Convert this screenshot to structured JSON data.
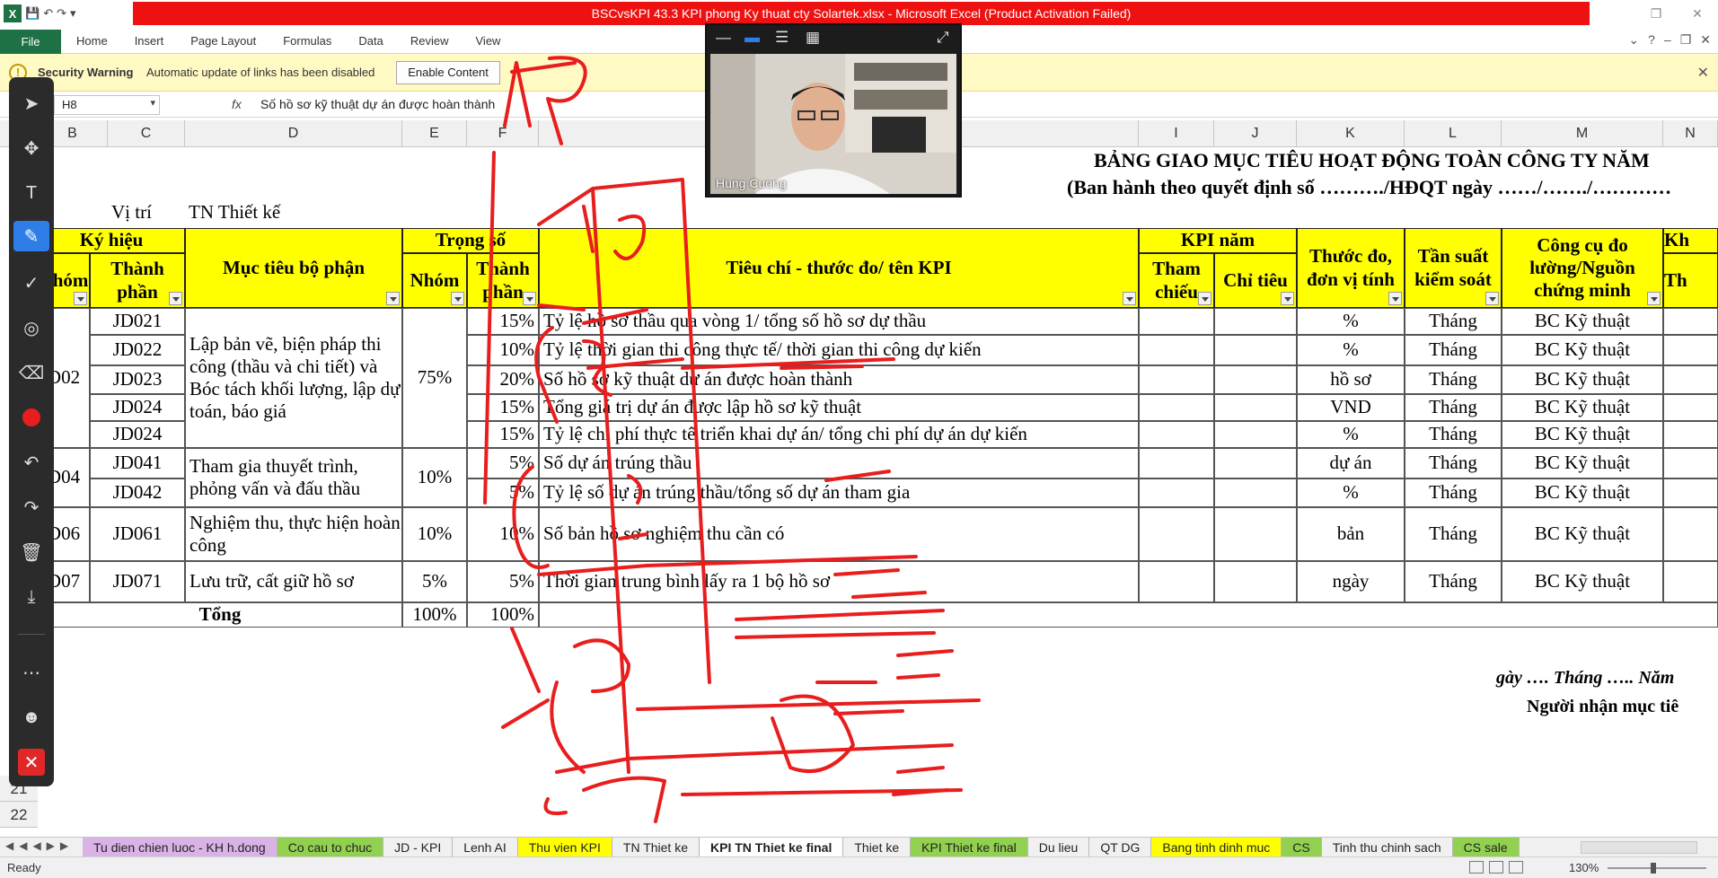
{
  "window": {
    "title": "BSCvsKPI 43.3 KPI phong Ky thuat cty Solartek.xlsx - Microsoft Excel (Product Activation Failed)",
    "app_icon": "X"
  },
  "ribbon": {
    "file": "File",
    "tabs": [
      "Home",
      "Insert",
      "Page Layout",
      "Formulas",
      "Data",
      "Review",
      "View"
    ]
  },
  "security": {
    "label": "Security Warning",
    "message": "Automatic update of links has been disabled",
    "button": "Enable Content"
  },
  "formula_bar": {
    "name_box": "H8",
    "fx": "fx",
    "formula": "Số hồ sơ kỹ thuật dự án được hoàn thành"
  },
  "columns": [
    "B",
    "C",
    "D",
    "E",
    "F",
    "I",
    "J",
    "K",
    "L",
    "M",
    "N"
  ],
  "sheet": {
    "title": "BẢNG GIAO MỤC TIÊU HOẠT ĐỘNG TOÀN CÔNG TY NĂM",
    "subtitle": "(Ban hành theo quyết định số ………./HĐQT ngày ……/……./…………",
    "position_label": "Vị trí",
    "position_value": "TN Thiết kế",
    "headers": {
      "ky_hieu": "Ký hiệu",
      "nhom": "Nhóm",
      "thanh_phan": "Thành phần",
      "muc_tieu": "Mục tiêu bộ phận",
      "trong_so": "Trọng số",
      "tieu_chi": "Tiêu chí - thước đo/ tên KPI",
      "kpi_nam": "KPI năm",
      "tham_chieu": "Tham chiếu",
      "chi_tieu": "Chỉ tiêu",
      "thuoc_do": "Thước đo, đơn vị tính",
      "tan_suat": "Tần suất kiểm soát",
      "cong_cu": "Công cụ đo lường/Nguồn chứng minh",
      "kh": "Kh",
      "th": "Th",
      "tha": "thá"
    },
    "groups": [
      {
        "code": "D02",
        "objective": "Lập bản vẽ, biện pháp thi công (thầu và chi tiết) và Bóc tách khối lượng, lập dự toán, báo giá",
        "weight": "75%"
      },
      {
        "code": "D04",
        "objective": "Tham gia thuyết trình, phỏng vấn và đấu thầu",
        "weight": "10%"
      },
      {
        "code": "D06",
        "objective": "Nghiệm thu, thực hiện hoàn công",
        "weight": "10%"
      },
      {
        "code": "D07",
        "objective": "Lưu trữ, cất giữ hồ sơ",
        "weight": "5%"
      }
    ],
    "rows": [
      {
        "code": "JD021",
        "weight": "15%",
        "kpi": "Tỷ lệ hồ sơ thầu qua vòng 1/ tổng số hồ sơ dự thầu",
        "unit": "%",
        "freq": "Tháng",
        "tool": "BC Kỹ thuật"
      },
      {
        "code": "JD022",
        "weight": "10%",
        "kpi": "Tỷ lệ thời gian thi công thực tế/ thời gian thi công dự kiến",
        "unit": "%",
        "freq": "Tháng",
        "tool": "BC Kỹ thuật"
      },
      {
        "code": "JD023",
        "weight": "20%",
        "kpi": "Số hồ sơ kỹ thuật dự án được hoàn thành",
        "unit": "hồ sơ",
        "freq": "Tháng",
        "tool": "BC Kỹ thuật"
      },
      {
        "code": "JD024",
        "weight": "15%",
        "kpi": "Tổng giá trị dự án được lập hồ sơ kỹ thuật",
        "unit": "VND",
        "freq": "Tháng",
        "tool": "BC Kỹ thuật"
      },
      {
        "code": "JD024",
        "weight": "15%",
        "kpi": "Tỷ lệ chi phí thực tế triển khai dự án/ tổng chi phí dự án dự kiến",
        "unit": "%",
        "freq": "Tháng",
        "tool": "BC Kỹ thuật"
      },
      {
        "code": "JD041",
        "weight": "5%",
        "kpi": "Số dự án trúng thầu",
        "unit": "dự án",
        "freq": "Tháng",
        "tool": "BC Kỹ thuật"
      },
      {
        "code": "JD042",
        "weight": "5%",
        "kpi": "Tỷ lệ số dự án trúng thầu/tổng số dự án tham gia",
        "unit": "%",
        "freq": "Tháng",
        "tool": "BC Kỹ thuật"
      },
      {
        "code": "JD061",
        "weight": "10%",
        "kpi": "Số bản hồ sơ nghiệm thu cần có",
        "unit": "bản",
        "freq": "Tháng",
        "tool": "BC Kỹ thuật"
      },
      {
        "code": "JD071",
        "weight": "5%",
        "kpi": "Thời gian trung bình lấy ra 1 bộ hồ sơ",
        "unit": "ngày",
        "freq": "Tháng",
        "tool": "BC Kỹ thuật"
      }
    ],
    "total_label": "Tổng",
    "total_group": "100%",
    "total_comp": "100%",
    "footer_date": "gày …. Tháng ….. Năm",
    "footer_receiver": "Người nhận mục tiê"
  },
  "row_numbers": [
    "21",
    "22"
  ],
  "sheet_tabs": [
    {
      "label": "Tu dien chien luoc - KH h.dong",
      "color": "#d9b3e6"
    },
    {
      "label": "Co cau to chuc",
      "color": "#92d050"
    },
    {
      "label": "JD - KPI",
      "color": ""
    },
    {
      "label": "Lenh AI",
      "color": ""
    },
    {
      "label": "Thu vien KPI",
      "color": "#ffff00"
    },
    {
      "label": "TN Thiet ke",
      "color": ""
    },
    {
      "label": "KPI TN Thiet ke final",
      "color": "#ffffff"
    },
    {
      "label": "Thiet ke",
      "color": ""
    },
    {
      "label": "KPI Thiet ke final",
      "color": "#92d050"
    },
    {
      "label": "Du lieu",
      "color": ""
    },
    {
      "label": "QT DG",
      "color": ""
    },
    {
      "label": "Bang tinh dinh muc",
      "color": "#ffff00"
    },
    {
      "label": "CS",
      "color": "#92d050"
    },
    {
      "label": "Tinh thu chinh sach",
      "color": ""
    },
    {
      "label": "CS sale",
      "color": "#92d050"
    }
  ],
  "status": {
    "ready": "Ready",
    "zoom": "130%"
  },
  "video": {
    "participant": "Hung Cuong"
  },
  "colors": {
    "excel_green": "#1e7145",
    "title_red": "#ee1111",
    "header_yellow": "#ffff00",
    "ink_red": "#e81e1e",
    "toolbar_blue": "#2f7ee8"
  }
}
